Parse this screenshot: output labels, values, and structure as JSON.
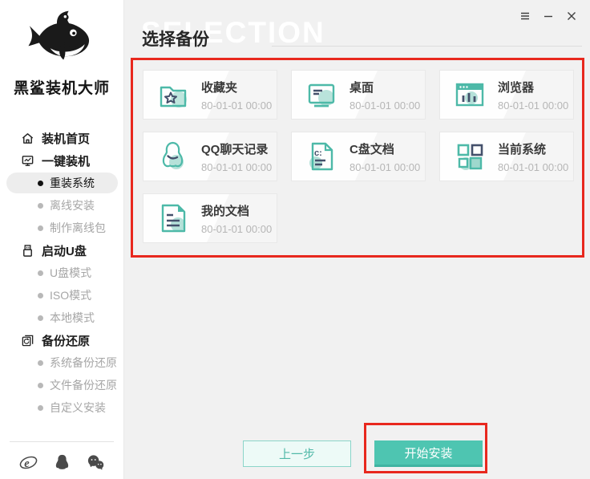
{
  "window": {
    "controls": {
      "menu": "menu",
      "minimize": "minimize",
      "close": "close"
    }
  },
  "sidebar": {
    "app_name": "黑鲨装机大师",
    "items": [
      {
        "label": "装机首页",
        "icon": "home-icon",
        "type": "section",
        "active": false
      },
      {
        "label": "一键装机",
        "icon": "monitor-chart-icon",
        "type": "section",
        "active": false
      },
      {
        "label": "重装系统",
        "type": "sub",
        "active": true
      },
      {
        "label": "离线安装",
        "type": "sub",
        "active": false
      },
      {
        "label": "制作离线包",
        "type": "sub",
        "active": false
      },
      {
        "label": "启动U盘",
        "icon": "usb-drive-icon",
        "type": "section",
        "active": false
      },
      {
        "label": "U盘模式",
        "type": "sub",
        "active": false
      },
      {
        "label": "ISO模式",
        "type": "sub",
        "active": false
      },
      {
        "label": "本地模式",
        "type": "sub",
        "active": false
      },
      {
        "label": "备份还原",
        "icon": "backup-restore-icon",
        "type": "section",
        "active": false
      },
      {
        "label": "系统备份还原",
        "type": "sub",
        "active": false
      },
      {
        "label": "文件备份还原",
        "type": "sub",
        "active": false
      },
      {
        "label": "自定义安装",
        "type": "sub",
        "active": false
      }
    ],
    "footer_icons": [
      "ie-icon",
      "qq-icon",
      "wechat-icon"
    ]
  },
  "main": {
    "watermark": "SELECTION",
    "title": "选择备份",
    "cards": [
      {
        "label": "收藏夹",
        "date": "80-01-01 00:00",
        "icon": "folder-star-icon"
      },
      {
        "label": "桌面",
        "date": "80-01-01 00:00",
        "icon": "desktop-icon"
      },
      {
        "label": "浏览器",
        "date": "80-01-01 00:00",
        "icon": "browser-icon"
      },
      {
        "label": "QQ聊天记录",
        "date": "80-01-01 00:00",
        "icon": "qq-chat-icon"
      },
      {
        "label": "C盘文档",
        "date": "80-01-01 00:00",
        "icon": "c-drive-doc-icon"
      },
      {
        "label": "当前系统",
        "date": "80-01-01 00:00",
        "icon": "system-squares-icon"
      },
      {
        "label": "我的文档",
        "date": "80-01-01 00:00",
        "icon": "my-docs-icon"
      }
    ],
    "buttons": {
      "prev": "上一步",
      "start": "开始安装"
    }
  },
  "colors": {
    "accent_teal": "#4ec5b1",
    "accent_teal_stroke": "#4db9a8",
    "accent_teal_light": "#a8dcd2",
    "dark_navy": "#44506b",
    "annotation_red": "#e8281e",
    "main_background": "#f1f1f1"
  }
}
